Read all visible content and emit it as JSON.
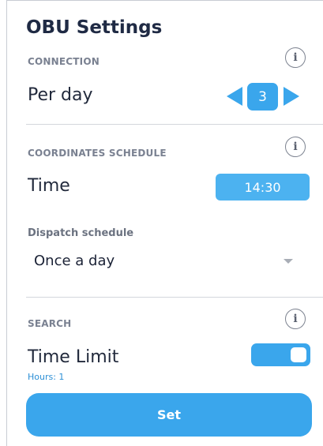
{
  "header": {
    "title": "OBU Settings"
  },
  "connection": {
    "section_label": "CONNECTION",
    "info_icon": "i",
    "row_label": "Per day",
    "count": "3"
  },
  "coordinates": {
    "section_label": "COORDINATES SCHEDULE",
    "info_icon": "i",
    "row_label": "Time",
    "time_value": "14:30",
    "dispatch_label": "Dispatch schedule",
    "dispatch_value": "Once a day"
  },
  "search": {
    "section_label": "SEARCH",
    "info_icon": "i",
    "row_label": "Time Limit",
    "toggle_on": true,
    "hours_text": "Hours: 1"
  },
  "actions": {
    "set_label": "Set"
  },
  "colors": {
    "accent": "#3aa6ec",
    "title": "#1f2a44",
    "muted": "#7a8191"
  }
}
